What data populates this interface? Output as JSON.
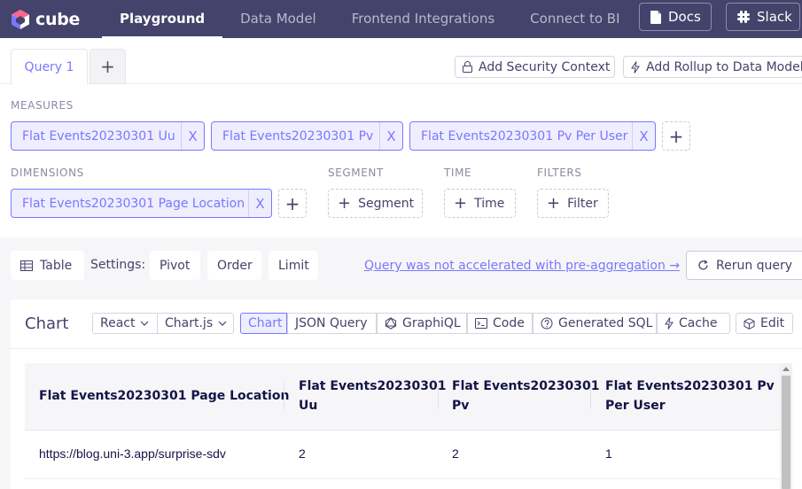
{
  "app": {
    "logo_text": "cube"
  },
  "nav": {
    "items": [
      {
        "label": "Playground",
        "active": true
      },
      {
        "label": "Data Model"
      },
      {
        "label": "Frontend Integrations"
      },
      {
        "label": "Connect to BI"
      }
    ],
    "docs_label": "Docs",
    "slack_label": "Slack"
  },
  "query_tabs": {
    "tab1": "Query 1",
    "add": "+"
  },
  "toolbar_top": {
    "security": "Add Security Context",
    "rollup": "Add Rollup to Data Model"
  },
  "measures": {
    "label": "MEASURES",
    "items": [
      "Flat Events20230301 Uu",
      "Flat Events20230301 Pv",
      "Flat Events20230301 Pv Per User"
    ]
  },
  "dimensions": {
    "label": "DIMENSIONS",
    "items": [
      "Flat Events20230301 Page Location"
    ]
  },
  "segment": {
    "label": "SEGMENT",
    "button": "Segment"
  },
  "time": {
    "label": "TIME",
    "button": "Time"
  },
  "filters": {
    "label": "FILTERS",
    "button": "Filter"
  },
  "close_glyph": "X",
  "plus_glyph": "+",
  "settings": {
    "table": "Table",
    "label": "Settings:",
    "pivot": "Pivot",
    "order": "Order",
    "limit": "Limit",
    "not_accelerated": "Query was not accelerated with pre-aggregation →",
    "rerun": "Rerun query"
  },
  "chart": {
    "title": "Chart",
    "react": "React",
    "chartjs": "Chart.js",
    "chart": "Chart",
    "json_query": "JSON Query",
    "graphiql": "GraphiQL",
    "code": "Code",
    "generated_sql": "Generated SQL",
    "cache": "Cache",
    "edit": "Edit"
  },
  "table": {
    "headers": [
      [
        "Flat Events20230301 Page Location"
      ],
      [
        "Flat Events20230301",
        "Uu"
      ],
      [
        "Flat Events20230301",
        "Pv"
      ],
      [
        "Flat Events20230301 Pv",
        "Per User"
      ]
    ],
    "rows": [
      [
        "https://blog.uni-3.app/surprise-sdv",
        "2",
        "2",
        "1"
      ]
    ]
  },
  "colors": {
    "nav_bg": "#43436b",
    "accent": "#7a77ff",
    "pill_bg": "#eeeeff"
  }
}
